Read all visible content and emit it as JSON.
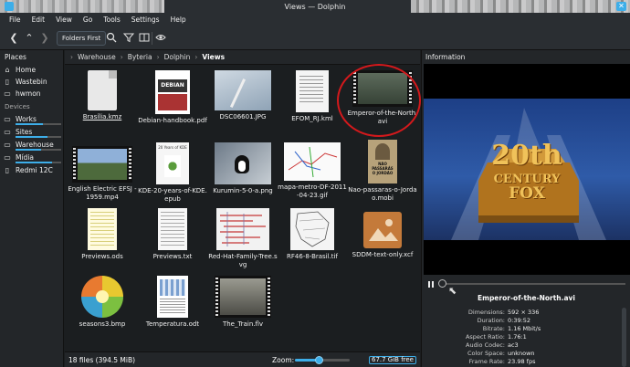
{
  "window": {
    "title": "Views — Dolphin"
  },
  "menu": [
    "File",
    "Edit",
    "View",
    "Go",
    "Tools",
    "Settings",
    "Help"
  ],
  "toolbar": {
    "folders_first": "Folders First"
  },
  "places": {
    "header": "Places",
    "items": [
      "Home",
      "Wastebin",
      "hwmon"
    ],
    "devices_header": "Devices",
    "devices": [
      {
        "label": "Works",
        "usage": 0.6
      },
      {
        "label": "Sites",
        "usage": 0.7
      },
      {
        "label": "Warehouse",
        "usage": 0.55
      },
      {
        "label": "Mídia",
        "usage": 0.8
      },
      {
        "label": "Redmi 12C",
        "usage": null
      }
    ]
  },
  "breadcrumb": [
    "Warehouse",
    "Byteria",
    "Dolphin",
    "Views"
  ],
  "files": [
    {
      "name": "Brasília.kmz"
    },
    {
      "name": "Debian-handbook.pdf"
    },
    {
      "name": "DSC06601.JPG"
    },
    {
      "name": "EFOM_RJ.kml"
    },
    {
      "name": "Emperor-of-the-North.avi"
    },
    {
      "name": "English Electric EFSJ - 1959.mp4"
    },
    {
      "name": "KDE-20-years-of-KDE.epub"
    },
    {
      "name": "Kurumin-5-0-a.png"
    },
    {
      "name": "mapa-metro-DF-2011-04-23.gif"
    },
    {
      "name": "Nao-passaras-o-Jordao.mobi"
    },
    {
      "name": "Previews.ods"
    },
    {
      "name": "Previews.txt"
    },
    {
      "name": "Red-Hat-Family-Tree.svg"
    },
    {
      "name": "RF46-8-Brasil.tif"
    },
    {
      "name": "SDDM-text-only.xcf"
    },
    {
      "name": "seasons3.bmp"
    },
    {
      "name": "Temperatura.odt"
    },
    {
      "name": "The_Train.flv"
    }
  ],
  "thumb_text": {
    "debian": "DEBIAN",
    "kde_years": "20 Years of KDE",
    "nao_passaras": "NÃO PASSARÁS O JORDÃO",
    "fox_line1": "20th",
    "fox_line2": "CENTURY",
    "fox_line3": "FOX"
  },
  "status": {
    "summary": "18 files (394.5 MiB)",
    "zoom_label": "Zoom:",
    "free": "67.7 GiB free"
  },
  "info": {
    "header": "Information",
    "filename": "Emperor-of-the-North.avi",
    "meta": [
      {
        "k": "Dimensions:",
        "v": "592 × 336"
      },
      {
        "k": "Duration:",
        "v": "0:39:52"
      },
      {
        "k": "Bitrate:",
        "v": "1.16 Mbit/s"
      },
      {
        "k": "Aspect Ratio:",
        "v": "1.76:1"
      },
      {
        "k": "Audio Codec:",
        "v": "ac3"
      },
      {
        "k": "Color Space:",
        "v": "unknown"
      },
      {
        "k": "Frame Rate:",
        "v": "23.98 fps"
      }
    ]
  },
  "colors": {
    "accent": "#3daee9",
    "highlight_circle": "#d4191c"
  }
}
